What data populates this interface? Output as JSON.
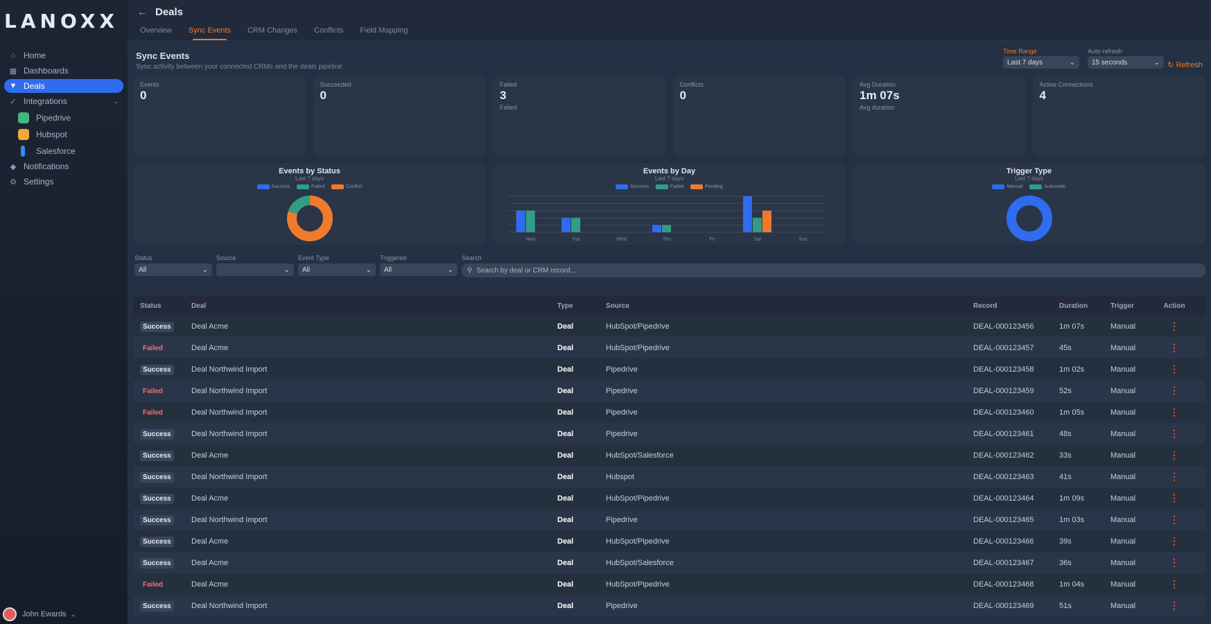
{
  "brand": {
    "logo_text": "LANOXX"
  },
  "sidebar": {
    "items": [
      {
        "label": "Home",
        "icon": "home-icon",
        "glyph": "⌂"
      },
      {
        "label": "Dashboards",
        "icon": "dashboard-icon",
        "glyph": "▦"
      },
      {
        "label": "Deals",
        "icon": "filter-icon",
        "glyph": "▼"
      },
      {
        "label": "Integrations",
        "icon": "check-icon",
        "glyph": "✓"
      }
    ],
    "subitems": [
      {
        "label": "Pipedrive",
        "color": "#3fb87a"
      },
      {
        "label": "Hubspot",
        "color": "#f2a93b"
      },
      {
        "label": "Salesforce",
        "color": "#2f8ff0"
      }
    ],
    "items_bottom": [
      {
        "label": "Notifications",
        "icon": "bell-icon",
        "glyph": "◆"
      },
      {
        "label": "Settings",
        "icon": "gear-icon",
        "glyph": "⚙"
      }
    ],
    "user": {
      "name": "John Ewards"
    }
  },
  "header": {
    "back_glyph": "←",
    "title": "Deals"
  },
  "tabs": [
    {
      "label": "Overview"
    },
    {
      "label": "Sync Events"
    },
    {
      "label": "CRM Changes"
    },
    {
      "label": "Conflicts"
    },
    {
      "label": "Field Mapping"
    }
  ],
  "section": {
    "title": "Sync Events",
    "subtitle": "Sync activity between your connected CRMs and the deals pipeline",
    "range_label": "Time Range",
    "range_value": "Last 7 days",
    "refresh_label": "Auto-refresh",
    "refresh_value": "15 seconds",
    "refresh_button": "↻ Refresh"
  },
  "kpis": [
    {
      "label": "Events",
      "value": "0",
      "sub": ""
    },
    {
      "label": "Succeeded",
      "value": "0",
      "sub": ""
    },
    {
      "label": "Failed",
      "value": "3",
      "sub": "Failed"
    },
    {
      "label": "Conflicts",
      "value": "0",
      "sub": ""
    },
    {
      "label": "Avg Duration",
      "value": "1m 07s",
      "sub": "Avg duration"
    },
    {
      "label": "Active Connections",
      "value": "4",
      "sub": ""
    }
  ],
  "charts": {
    "donut1": {
      "title": "Events by Status",
      "subtitle": "Last 7 days",
      "legend": [
        "Success",
        "Failed",
        "Conflict"
      ]
    },
    "bars": {
      "title": "Events by Day",
      "subtitle": "Last 7 days",
      "legend": [
        "Success",
        "Failed",
        "Pending"
      ],
      "xlabels": [
        "Mon",
        "Tue",
        "Wed",
        "Thu",
        "Fri",
        "Sat",
        "Sun"
      ]
    },
    "donut2": {
      "title": "Trigger Type",
      "subtitle": "Last 7 days",
      "legend": [
        "Manual",
        "Automatic"
      ]
    }
  },
  "chart_data": [
    {
      "type": "pie",
      "title": "Events by Status",
      "labels": [
        "Success",
        "Failed",
        "Conflict"
      ],
      "values": [
        80,
        20,
        0
      ],
      "colors": [
        "#f07a2c",
        "#2f9e84",
        "#f07a2c"
      ]
    },
    {
      "type": "bar",
      "title": "Events by Day",
      "categories": [
        "Mon",
        "Tue",
        "Wed",
        "Thu",
        "Fri",
        "Sat",
        "Sun"
      ],
      "series": [
        {
          "name": "Success",
          "values": [
            3,
            2,
            0,
            1,
            0,
            5,
            0
          ],
          "color": "#2f6cf0"
        },
        {
          "name": "Failed",
          "values": [
            3,
            2,
            0,
            1,
            0,
            2,
            0
          ],
          "color": "#2f9e84"
        },
        {
          "name": "Pending",
          "values": [
            0,
            0,
            0,
            0,
            0,
            3,
            0
          ],
          "color": "#f07a2c"
        }
      ],
      "ylim": [
        0,
        5
      ]
    },
    {
      "type": "pie",
      "title": "Trigger Type",
      "labels": [
        "Manual",
        "Automatic"
      ],
      "values": [
        100,
        0
      ],
      "colors": [
        "#2f6cf0",
        "#2f9e84"
      ]
    }
  ],
  "filters": {
    "status": {
      "label": "Status",
      "value": "All"
    },
    "source": {
      "label": "Source",
      "value": ""
    },
    "event_type": {
      "label": "Event Type",
      "value": "All"
    },
    "triggered": {
      "label": "Triggered",
      "value": "All"
    },
    "search": {
      "label": "Search",
      "placeholder": "Search by deal or CRM record..."
    }
  },
  "table": {
    "headers": [
      "Status",
      "Deal",
      "Type",
      "Source",
      "Record",
      "Duration",
      "Trigger",
      "Action"
    ],
    "rows": [
      {
        "status": "Success",
        "fail": false,
        "deal": "Deal Acme",
        "type": "Deal",
        "source": "HubSpot/Pipedrive",
        "record": "DEAL-000123456",
        "duration": "1m 07s",
        "trigger": "Manual",
        "action": "⋮"
      },
      {
        "status": "Failed",
        "fail": true,
        "deal": "Deal Acme",
        "type": "Deal",
        "source": "HubSpot/Pipedrive",
        "record": "DEAL-000123457",
        "duration": "45s",
        "trigger": "Manual",
        "action": "⋮"
      },
      {
        "status": "Success",
        "fail": false,
        "deal": "Deal Northwind Import",
        "type": "Deal",
        "source": "Pipedrive",
        "record": "DEAL-000123458",
        "duration": "1m 02s",
        "trigger": "Manual",
        "action": "⋮"
      },
      {
        "status": "Failed",
        "fail": true,
        "deal": "Deal Northwind Import",
        "type": "Deal",
        "source": "Pipedrive",
        "record": "DEAL-000123459",
        "duration": "52s",
        "trigger": "Manual",
        "action": "⋮"
      },
      {
        "status": "Failed",
        "fail": true,
        "deal": "Deal Northwind Import",
        "type": "Deal",
        "source": "Pipedrive",
        "record": "DEAL-000123460",
        "duration": "1m 05s",
        "trigger": "Manual",
        "action": "⋮"
      },
      {
        "status": "Success",
        "fail": false,
        "deal": "Deal Northwind Import",
        "type": "Deal",
        "source": "Pipedrive",
        "record": "DEAL-000123461",
        "duration": "48s",
        "trigger": "Manual",
        "action": "⋮"
      },
      {
        "status": "Success",
        "fail": false,
        "deal": "Deal Acme",
        "type": "Deal",
        "source": "HubSpot/Salesforce",
        "record": "DEAL-000123462",
        "duration": "33s",
        "trigger": "Manual",
        "action": "⋮"
      },
      {
        "status": "Success",
        "fail": false,
        "deal": "Deal Northwind Import",
        "type": "Deal",
        "source": "Hubspot",
        "record": "DEAL-000123463",
        "duration": "41s",
        "trigger": "Manual",
        "action": "⋮"
      },
      {
        "status": "Success",
        "fail": false,
        "deal": "Deal Acme",
        "type": "Deal",
        "source": "HubSpot/Pipedrive",
        "record": "DEAL-000123464",
        "duration": "1m 09s",
        "trigger": "Manual",
        "action": "⋮"
      },
      {
        "status": "Success",
        "fail": false,
        "deal": "Deal Northwind Import",
        "type": "Deal",
        "source": "Pipedrive",
        "record": "DEAL-000123465",
        "duration": "1m 03s",
        "trigger": "Manual",
        "action": "⋮"
      },
      {
        "status": "Success",
        "fail": false,
        "deal": "Deal Acme",
        "type": "Deal",
        "source": "HubSpot/Pipedrive",
        "record": "DEAL-000123466",
        "duration": "39s",
        "trigger": "Manual",
        "action": "⋮"
      },
      {
        "status": "Success",
        "fail": false,
        "deal": "Deal Acme",
        "type": "Deal",
        "source": "HubSpot/Salesforce",
        "record": "DEAL-000123467",
        "duration": "36s",
        "trigger": "Manual",
        "action": "⋮"
      },
      {
        "status": "Failed",
        "fail": true,
        "deal": "Deal Acme",
        "type": "Deal",
        "source": "HubSpot/Pipedrive",
        "record": "DEAL-000123468",
        "duration": "1m 04s",
        "trigger": "Manual",
        "action": "⋮"
      },
      {
        "status": "Success",
        "fail": false,
        "deal": "Deal Northwind Import",
        "type": "Deal",
        "source": "Pipedrive",
        "record": "DEAL-000123469",
        "duration": "51s",
        "trigger": "Manual",
        "action": "⋮"
      }
    ]
  }
}
